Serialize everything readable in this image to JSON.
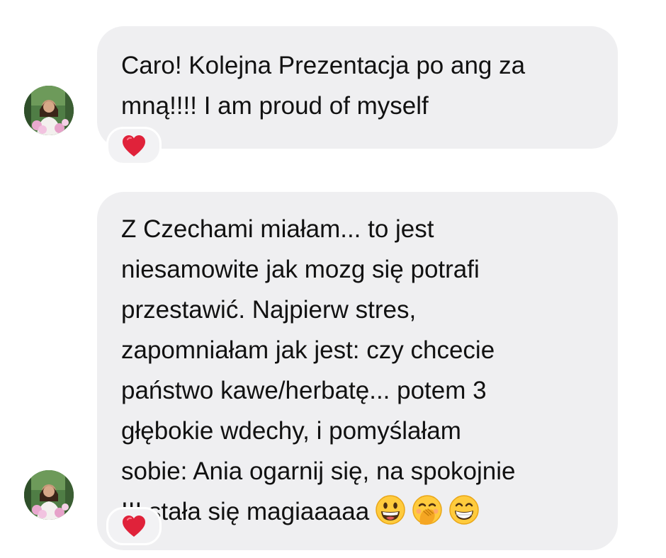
{
  "thread": {
    "messages": [
      {
        "lines": [
          "Caro! Kolejna Prezentacja po ang za",
          "mną!!!! I am proud of myself"
        ],
        "reaction": "heart"
      },
      {
        "lines": [
          "Z Czechami miałam... to jest",
          "niesamowite jak mozg się potrafi",
          "przestawić. Najpierw stres,",
          "zapomniałam jak jest: czy chcecie",
          "państwo kawe/herbatę... potem 3",
          "głębokie wdechy, i pomyślałam",
          "sobie: Ania ogarnij się, na spokojnie",
          "III stała się magiaaaaa"
        ],
        "emojis": [
          "grinning-face-big-eyes",
          "face-with-hand-over-mouth",
          "beaming-face"
        ],
        "reaction": "heart"
      }
    ]
  },
  "colors": {
    "bubble_bg": "#efeff1",
    "text": "#111111",
    "heart": "#e0223a"
  }
}
